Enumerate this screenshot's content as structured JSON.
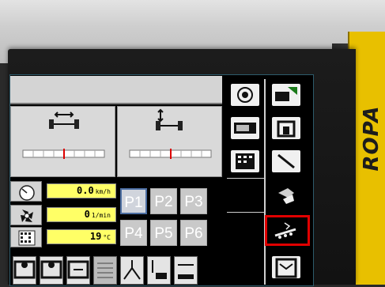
{
  "brand": {
    "name": "ROPA"
  },
  "readouts": [
    {
      "icon": "speedometer-icon",
      "value": "0.0",
      "unit": "km/h"
    },
    {
      "icon": "fan-icon",
      "value": "0",
      "unit": "1/min"
    },
    {
      "icon": "oil-temperature-icon",
      "value": "19",
      "unit": "°C"
    }
  ],
  "preset_buttons": [
    {
      "label": "P1",
      "selected": true
    },
    {
      "label": "P2",
      "selected": false
    },
    {
      "label": "P3",
      "selected": false
    },
    {
      "label": "P4",
      "selected": false
    },
    {
      "label": "P5",
      "selected": false
    },
    {
      "label": "P6",
      "selected": false
    }
  ],
  "track_panels": [
    {
      "icon": "axle-width-icon"
    },
    {
      "icon": "axle-height-icon"
    }
  ],
  "sidebar_buttons": [
    {
      "icon": "settings-rotate-icon"
    },
    {
      "icon": "harvester-unload-icon"
    },
    {
      "icon": "display-unit-icon"
    },
    {
      "icon": "machine-front-icon"
    },
    {
      "icon": "keypad-icon"
    },
    {
      "icon": "sensor-wand-icon"
    },
    {
      "icon": "conveyor-icon"
    },
    {
      "icon": "cleaning-conveyor-icon"
    },
    {
      "icon": "bunker-icon"
    }
  ],
  "bottom_buttons": [
    {
      "icon": "topper-icon"
    },
    {
      "icon": "rotor-icon"
    },
    {
      "icon": "width-adjust-icon"
    },
    {
      "icon": "grid-icon"
    },
    {
      "icon": "lift-icon"
    },
    {
      "icon": "depth-icon"
    },
    {
      "icon": "spread-icon"
    }
  ],
  "highlight_color": "#e00000",
  "readout_color": "#ffff66"
}
